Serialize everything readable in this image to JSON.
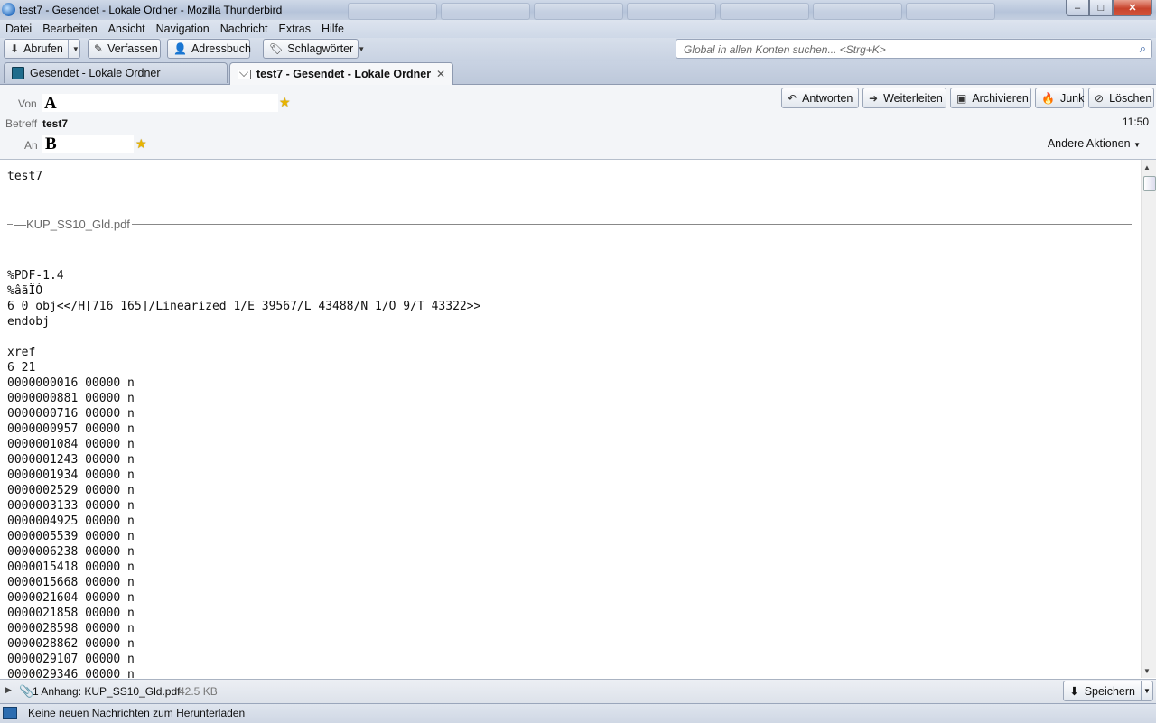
{
  "window": {
    "title": "test7 - Gesendet - Lokale Ordner - Mozilla Thunderbird",
    "controls": {
      "minimize": "–",
      "maximize": "□",
      "close": "✕"
    }
  },
  "menu": [
    {
      "label": "Datei"
    },
    {
      "label": "Bearbeiten"
    },
    {
      "label": "Ansicht"
    },
    {
      "label": "Navigation"
    },
    {
      "label": "Nachricht"
    },
    {
      "label": "Extras"
    },
    {
      "label": "Hilfe"
    }
  ],
  "toolbar": {
    "get_mail": "Abrufen",
    "compose": "Verfassen",
    "address_book": "Adressbuch",
    "tags": "Schlagwörter",
    "search_placeholder": "Global in allen Konten suchen... <Strg+K>"
  },
  "tabs": [
    {
      "label": "Gesendet - Lokale Ordner",
      "active": false
    },
    {
      "label": "test7 - Gesendet - Lokale Ordner",
      "active": true
    }
  ],
  "header": {
    "from_label": "Von",
    "from_value": "A",
    "subject_label": "Betreff",
    "subject_value": "test7",
    "to_label": "An",
    "to_value": "B",
    "time": "11:50",
    "actions": {
      "reply": "Antworten",
      "forward": "Weiterleiten",
      "archive": "Archivieren",
      "junk": "Junk",
      "delete": "Löschen",
      "other": "Andere Aktionen"
    }
  },
  "body": {
    "greeting": "test7",
    "attachment_separator": "KUP_SS10_Gld.pdf",
    "pdf_lines": "%PDF-1.4\n%âãÏÓ\n6 0 obj<</H[716 165]/Linearized 1/E 39567/L 43488/N 1/O 9/T 43322>>\nendobj\n\nxref\n6 21\n0000000016 00000 n\n0000000881 00000 n\n0000000716 00000 n\n0000000957 00000 n\n0000001084 00000 n\n0000001243 00000 n\n0000001934 00000 n\n0000002529 00000 n\n0000003133 00000 n\n0000004925 00000 n\n0000005539 00000 n\n0000006238 00000 n\n0000015418 00000 n\n0000015668 00000 n\n0000021604 00000 n\n0000021858 00000 n\n0000028598 00000 n\n0000028862 00000 n\n0000029107 00000 n\n0000029346 00000 n"
  },
  "attachments": {
    "label": "1 Anhang: KUP_SS10_Gld.pdf",
    "size": "42.5 KB",
    "save": "Speichern"
  },
  "status": {
    "text": "Keine neuen Nachrichten zum Herunterladen"
  }
}
